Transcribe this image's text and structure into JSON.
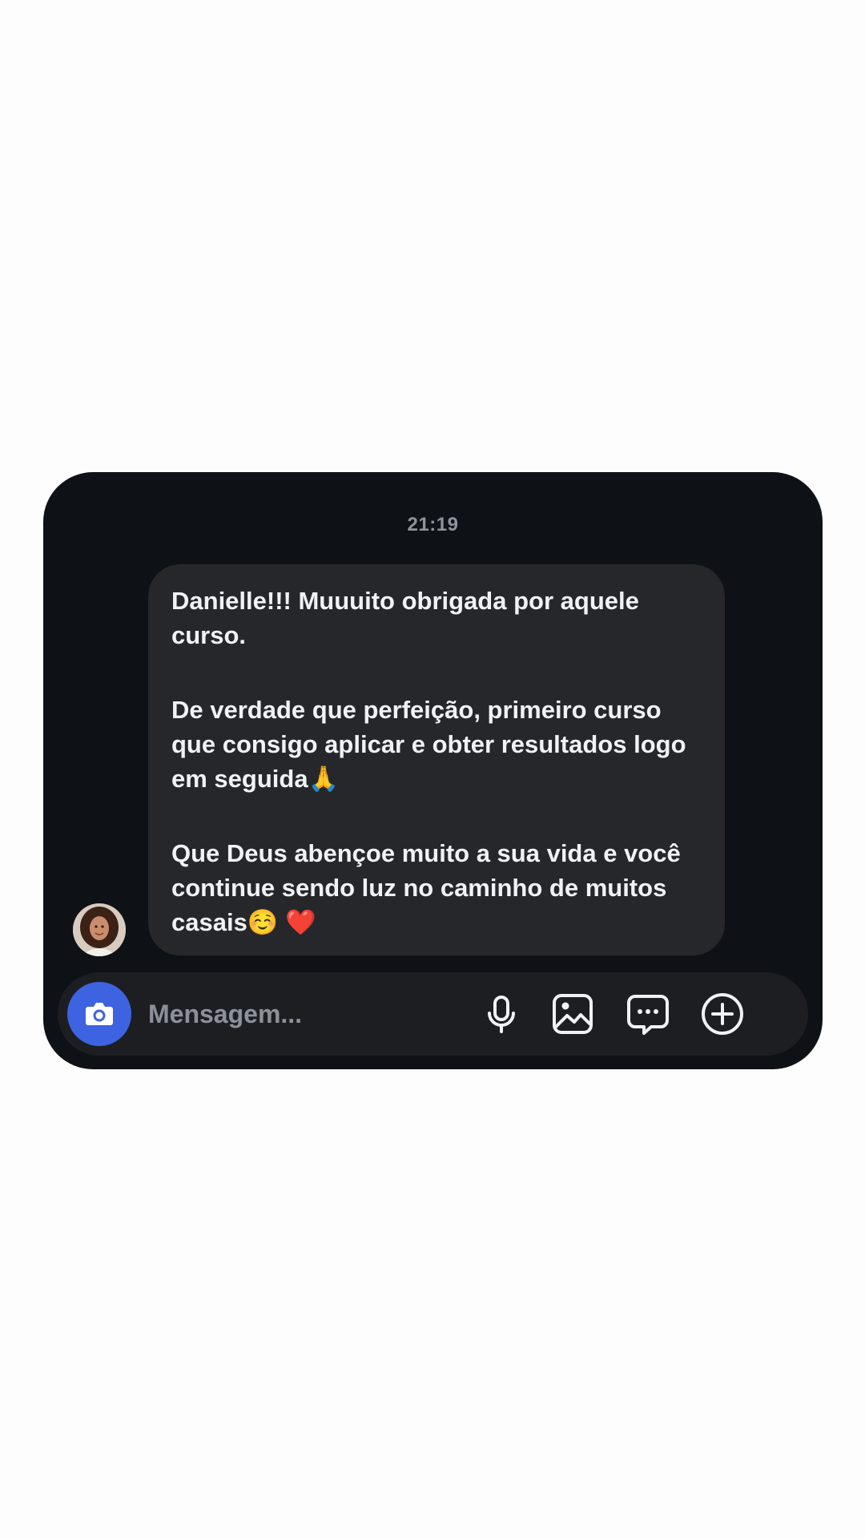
{
  "chat": {
    "timestamp": "21:19",
    "message": {
      "paragraph_1": "Danielle!!! Muuuito obrigada por aquele curso.",
      "paragraph_2_text": "De verdade que perfeição, primeiro curso que consigo aplicar e obter resultados logo em seguida",
      "paragraph_2_emoji": "🙏",
      "paragraph_3_text": "Que Deus abençoe muito a sua vida e você continue sendo luz no caminho de muitos casais",
      "paragraph_3_emoji_1": "☺️",
      "paragraph_3_emoji_2": "❤️"
    }
  },
  "composer": {
    "placeholder": "Mensagem..."
  },
  "colors": {
    "page_background": "#fefdfd",
    "card_background": "#0e1116",
    "bubble_background": "#25272b",
    "composer_background": "#1c1e22",
    "camera_button": "#3e63e0",
    "text_primary": "#f1f2f4",
    "text_muted": "#8f939b"
  },
  "icons": {
    "camera": "camera-icon",
    "microphone": "microphone-icon",
    "gallery": "image-gallery-icon",
    "sticker": "sticker-message-icon",
    "plus": "plus-circle-icon"
  }
}
